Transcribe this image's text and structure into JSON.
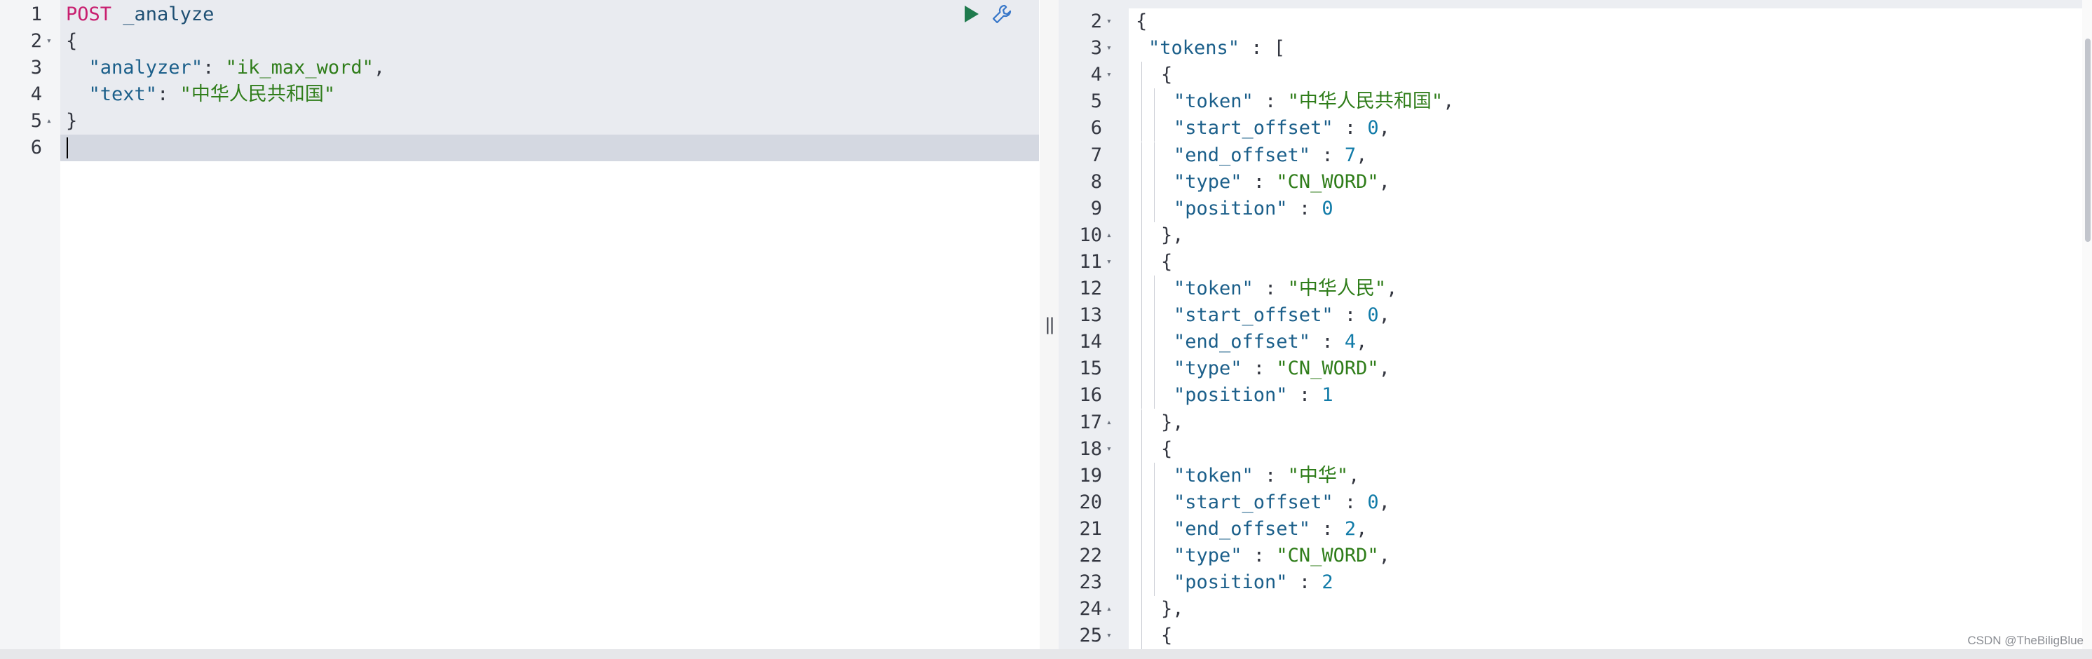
{
  "request_editor": {
    "toolbar": {
      "run_icon": "play-icon",
      "settings_icon": "wrench-icon"
    },
    "lines": [
      {
        "num": "1",
        "fold": "",
        "tokens": [
          {
            "t": "POST",
            "c": "method"
          },
          {
            "t": " _analyze",
            "c": "path"
          }
        ]
      },
      {
        "num": "2",
        "fold": "▾",
        "tokens": [
          {
            "t": "{",
            "c": "punc"
          }
        ]
      },
      {
        "num": "3",
        "fold": "",
        "tokens": [
          {
            "t": "  ",
            "c": "punc"
          },
          {
            "t": "\"analyzer\"",
            "c": "key"
          },
          {
            "t": ": ",
            "c": "punc"
          },
          {
            "t": "\"ik_max_word\"",
            "c": "str"
          },
          {
            "t": ",",
            "c": "punc"
          }
        ]
      },
      {
        "num": "4",
        "fold": "",
        "tokens": [
          {
            "t": "  ",
            "c": "punc"
          },
          {
            "t": "\"text\"",
            "c": "key"
          },
          {
            "t": ": ",
            "c": "punc"
          },
          {
            "t": "\"中华人民共和国\"",
            "c": "str"
          }
        ]
      },
      {
        "num": "5",
        "fold": "▴",
        "tokens": [
          {
            "t": "}",
            "c": "punc"
          }
        ]
      },
      {
        "num": "6",
        "fold": "",
        "tokens": []
      }
    ]
  },
  "splitter": {
    "label": "||"
  },
  "response_viewer": {
    "lines": [
      {
        "num": "2",
        "fold": "▾",
        "indent": 0,
        "tokens": [
          {
            "t": "{",
            "c": "punc"
          }
        ]
      },
      {
        "num": "3",
        "fold": "▾",
        "indent": 1,
        "tokens": [
          {
            "t": "\"tokens\"",
            "c": "key"
          },
          {
            "t": " : [",
            "c": "punc"
          }
        ]
      },
      {
        "num": "4",
        "fold": "▾",
        "indent": 2,
        "tokens": [
          {
            "t": "{",
            "c": "punc"
          }
        ]
      },
      {
        "num": "5",
        "fold": "",
        "indent": 3,
        "tokens": [
          {
            "t": "\"token\"",
            "c": "key"
          },
          {
            "t": " : ",
            "c": "punc"
          },
          {
            "t": "\"中华人民共和国\"",
            "c": "str"
          },
          {
            "t": ",",
            "c": "punc"
          }
        ]
      },
      {
        "num": "6",
        "fold": "",
        "indent": 3,
        "tokens": [
          {
            "t": "\"start_offset\"",
            "c": "key"
          },
          {
            "t": " : ",
            "c": "punc"
          },
          {
            "t": "0",
            "c": "num"
          },
          {
            "t": ",",
            "c": "punc"
          }
        ]
      },
      {
        "num": "7",
        "fold": "",
        "indent": 3,
        "tokens": [
          {
            "t": "\"end_offset\"",
            "c": "key"
          },
          {
            "t": " : ",
            "c": "punc"
          },
          {
            "t": "7",
            "c": "num"
          },
          {
            "t": ",",
            "c": "punc"
          }
        ]
      },
      {
        "num": "8",
        "fold": "",
        "indent": 3,
        "tokens": [
          {
            "t": "\"type\"",
            "c": "key"
          },
          {
            "t": " : ",
            "c": "punc"
          },
          {
            "t": "\"CN_WORD\"",
            "c": "str"
          },
          {
            "t": ",",
            "c": "punc"
          }
        ]
      },
      {
        "num": "9",
        "fold": "",
        "indent": 3,
        "tokens": [
          {
            "t": "\"position\"",
            "c": "key"
          },
          {
            "t": " : ",
            "c": "punc"
          },
          {
            "t": "0",
            "c": "num"
          }
        ]
      },
      {
        "num": "10",
        "fold": "▴",
        "indent": 2,
        "tokens": [
          {
            "t": "},",
            "c": "punc"
          }
        ]
      },
      {
        "num": "11",
        "fold": "▾",
        "indent": 2,
        "tokens": [
          {
            "t": "{",
            "c": "punc"
          }
        ]
      },
      {
        "num": "12",
        "fold": "",
        "indent": 3,
        "tokens": [
          {
            "t": "\"token\"",
            "c": "key"
          },
          {
            "t": " : ",
            "c": "punc"
          },
          {
            "t": "\"中华人民\"",
            "c": "str"
          },
          {
            "t": ",",
            "c": "punc"
          }
        ]
      },
      {
        "num": "13",
        "fold": "",
        "indent": 3,
        "tokens": [
          {
            "t": "\"start_offset\"",
            "c": "key"
          },
          {
            "t": " : ",
            "c": "punc"
          },
          {
            "t": "0",
            "c": "num"
          },
          {
            "t": ",",
            "c": "punc"
          }
        ]
      },
      {
        "num": "14",
        "fold": "",
        "indent": 3,
        "tokens": [
          {
            "t": "\"end_offset\"",
            "c": "key"
          },
          {
            "t": " : ",
            "c": "punc"
          },
          {
            "t": "4",
            "c": "num"
          },
          {
            "t": ",",
            "c": "punc"
          }
        ]
      },
      {
        "num": "15",
        "fold": "",
        "indent": 3,
        "tokens": [
          {
            "t": "\"type\"",
            "c": "key"
          },
          {
            "t": " : ",
            "c": "punc"
          },
          {
            "t": "\"CN_WORD\"",
            "c": "str"
          },
          {
            "t": ",",
            "c": "punc"
          }
        ]
      },
      {
        "num": "16",
        "fold": "",
        "indent": 3,
        "tokens": [
          {
            "t": "\"position\"",
            "c": "key"
          },
          {
            "t": " : ",
            "c": "punc"
          },
          {
            "t": "1",
            "c": "num"
          }
        ]
      },
      {
        "num": "17",
        "fold": "▴",
        "indent": 2,
        "tokens": [
          {
            "t": "},",
            "c": "punc"
          }
        ]
      },
      {
        "num": "18",
        "fold": "▾",
        "indent": 2,
        "tokens": [
          {
            "t": "{",
            "c": "punc"
          }
        ]
      },
      {
        "num": "19",
        "fold": "",
        "indent": 3,
        "tokens": [
          {
            "t": "\"token\"",
            "c": "key"
          },
          {
            "t": " : ",
            "c": "punc"
          },
          {
            "t": "\"中华\"",
            "c": "str"
          },
          {
            "t": ",",
            "c": "punc"
          }
        ]
      },
      {
        "num": "20",
        "fold": "",
        "indent": 3,
        "tokens": [
          {
            "t": "\"start_offset\"",
            "c": "key"
          },
          {
            "t": " : ",
            "c": "punc"
          },
          {
            "t": "0",
            "c": "num"
          },
          {
            "t": ",",
            "c": "punc"
          }
        ]
      },
      {
        "num": "21",
        "fold": "",
        "indent": 3,
        "tokens": [
          {
            "t": "\"end_offset\"",
            "c": "key"
          },
          {
            "t": " : ",
            "c": "punc"
          },
          {
            "t": "2",
            "c": "num"
          },
          {
            "t": ",",
            "c": "punc"
          }
        ]
      },
      {
        "num": "22",
        "fold": "",
        "indent": 3,
        "tokens": [
          {
            "t": "\"type\"",
            "c": "key"
          },
          {
            "t": " : ",
            "c": "punc"
          },
          {
            "t": "\"CN_WORD\"",
            "c": "str"
          },
          {
            "t": ",",
            "c": "punc"
          }
        ]
      },
      {
        "num": "23",
        "fold": "",
        "indent": 3,
        "tokens": [
          {
            "t": "\"position\"",
            "c": "key"
          },
          {
            "t": " : ",
            "c": "punc"
          },
          {
            "t": "2",
            "c": "num"
          }
        ]
      },
      {
        "num": "24",
        "fold": "▴",
        "indent": 2,
        "tokens": [
          {
            "t": "},",
            "c": "punc"
          }
        ]
      },
      {
        "num": "25",
        "fold": "▾",
        "indent": 2,
        "tokens": [
          {
            "t": "{",
            "c": "punc"
          }
        ]
      }
    ]
  },
  "watermark": "CSDN @TheBiligBlue",
  "colors": {
    "method": "#c81e6f",
    "key": "#1b5f8a",
    "string": "#2f7d1a",
    "number": "#117ba8"
  }
}
